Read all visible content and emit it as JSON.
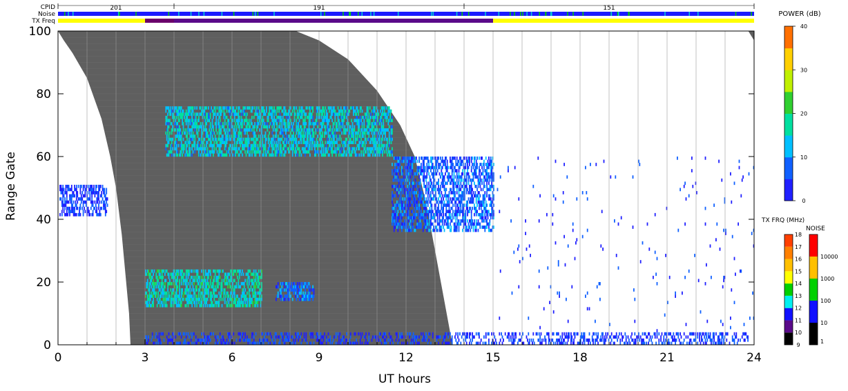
{
  "chart_data": {
    "type": "heatmap",
    "xlabel": "UT hours",
    "ylabel": "Range Gate",
    "xlim": [
      0,
      24
    ],
    "ylim": [
      0,
      100
    ],
    "x_ticks": [
      0,
      3,
      6,
      9,
      12,
      15,
      18,
      21,
      24
    ],
    "y_ticks": [
      0,
      20,
      40,
      60,
      80,
      100
    ],
    "grid": "vertical lines every 1 hour",
    "header_rows": {
      "cpid_label": "CPID",
      "noise_label": "Noise",
      "txfreq_label": "TX Freq",
      "cpid_segments": [
        {
          "label": "201",
          "start": 0,
          "end": 4
        },
        {
          "label": "191",
          "start": 4,
          "end": 14
        },
        {
          "label": "151",
          "start": 14,
          "end": 24
        }
      ],
      "txfreq_segments": [
        {
          "start": 0,
          "end": 3,
          "color": "#ffff00"
        },
        {
          "start": 3,
          "end": 4,
          "color": "#6a006a"
        },
        {
          "start": 4,
          "end": 15,
          "color": "#5a0a8a"
        },
        {
          "start": 15,
          "end": 24,
          "color": "#ffff00"
        }
      ]
    },
    "gray_region_description": "ground scatter (dark gray) region",
    "gray_region_boundary": {
      "left_edge": [
        [
          0,
          100
        ],
        [
          0.2,
          97
        ],
        [
          0.5,
          93
        ],
        [
          1.0,
          85
        ],
        [
          1.5,
          72
        ],
        [
          1.8,
          60
        ],
        [
          2.0,
          50
        ],
        [
          2.2,
          35
        ],
        [
          2.35,
          20
        ],
        [
          2.45,
          10
        ],
        [
          2.5,
          0
        ]
      ],
      "right_edge": [
        [
          8.2,
          100
        ],
        [
          9,
          97
        ],
        [
          10,
          91
        ],
        [
          11,
          81
        ],
        [
          11.8,
          70
        ],
        [
          12.3,
          60
        ],
        [
          12.7,
          45
        ],
        [
          13.0,
          30
        ],
        [
          13.3,
          15
        ],
        [
          13.6,
          0
        ]
      ],
      "top_right_wedge": [
        [
          23.8,
          100
        ],
        [
          24,
          100
        ],
        [
          24,
          97
        ]
      ]
    },
    "echo_regions": [
      {
        "name": "band-70",
        "x_start": 3.7,
        "x_end": 11.5,
        "y_center": 68,
        "y_half": 8,
        "power": 14
      },
      {
        "name": "band-20",
        "x_start": 3.0,
        "x_end": 7.0,
        "y_center": 18,
        "y_half": 6,
        "power": 16
      },
      {
        "name": "patch-17",
        "x_start": 7.5,
        "x_end": 8.8,
        "y_center": 17,
        "y_half": 3,
        "power": 8
      },
      {
        "name": "early-45",
        "x_start": 0.05,
        "x_end": 1.7,
        "y_center": 46,
        "y_half": 5,
        "power": 5
      },
      {
        "name": "decay-tail",
        "x_start": 11.5,
        "x_end": 15.0,
        "y_center": 48,
        "y_half": 12,
        "power": 7
      },
      {
        "name": "low-band",
        "x_start": 3.0,
        "x_end": 23.8,
        "y_center": 2,
        "y_half": 2,
        "power": 5
      },
      {
        "name": "late-sparse",
        "x_start": 15,
        "x_end": 24,
        "y_center": 30,
        "y_half": 30,
        "power": 4
      }
    ],
    "colorbars": {
      "power": {
        "title": "POWER (dB)",
        "ticks": [
          "0",
          "10",
          "20",
          "30",
          "40"
        ]
      },
      "txfrq": {
        "title": "TX FRQ (MHz)",
        "ticks": [
          "9",
          "10",
          "11",
          "12",
          "13",
          "14",
          "15",
          "16",
          "17",
          "18"
        ],
        "colors": [
          "#000000",
          "#5a0a8a",
          "#1010ff",
          "#00f0f0",
          "#00d000",
          "#ffff00",
          "#ffc000",
          "#ff8000",
          "#ff4000",
          "#ff0000"
        ]
      },
      "noise": {
        "title": "NOISE",
        "ticks": [
          "1",
          "10",
          "100",
          "1000",
          "10000"
        ],
        "colors": [
          "#000000",
          "#1010ff",
          "#00d000",
          "#ffc000",
          "#ff0000"
        ]
      }
    },
    "colors": {
      "ground_scatter": "#5f5f5f",
      "noise_bar": "#1a1aff",
      "grid": "#999999"
    }
  }
}
